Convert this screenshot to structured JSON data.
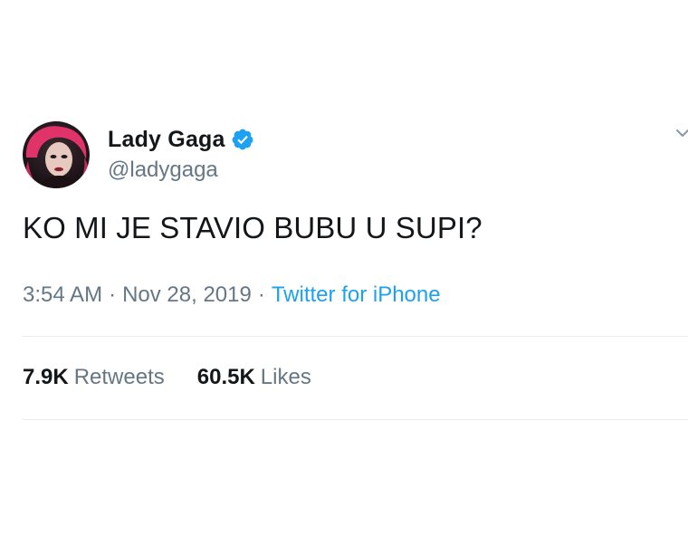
{
  "tweet": {
    "author": {
      "display_name": "Lady Gaga",
      "handle": "@ladygaga",
      "verified": true,
      "avatar_icon": "profile-photo"
    },
    "text": "KO MI JE STAVIO BUBU U SUPI?",
    "time": "3:54 AM",
    "date": "Nov 28, 2019",
    "separator": "·",
    "source": "Twitter for iPhone",
    "stats": {
      "retweets_count": "7.9K",
      "retweets_label": "Retweets",
      "likes_count": "60.5K",
      "likes_label": "Likes"
    },
    "menu_icon": "chevron-down-icon"
  },
  "colors": {
    "text": "#14171a",
    "secondary": "#657786",
    "accent": "#1da1f2",
    "divider": "#e6ecf0"
  }
}
